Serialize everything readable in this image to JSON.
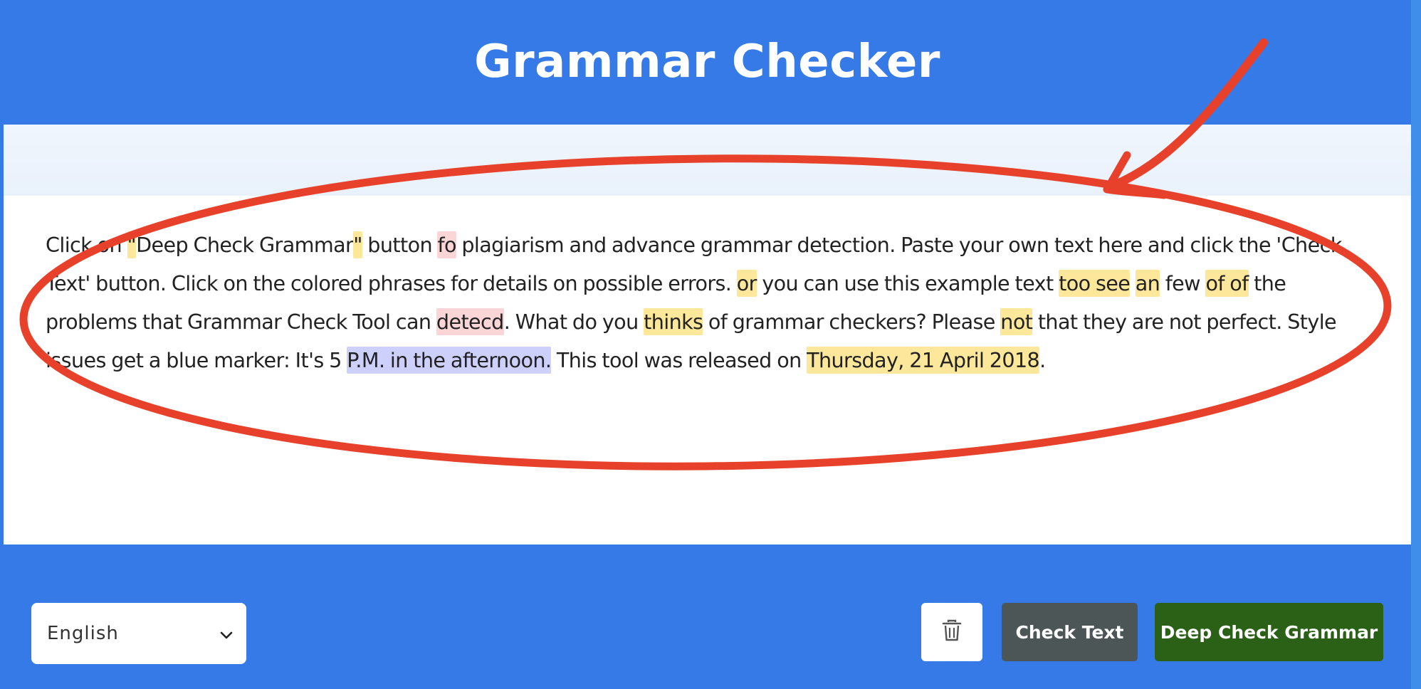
{
  "app": {
    "title": "Grammar Checker"
  },
  "editor": {
    "segments": [
      {
        "text": "Click on ",
        "mark": ""
      },
      {
        "text": "\"",
        "mark": "yellow"
      },
      {
        "text": "Deep Check Grammar",
        "mark": ""
      },
      {
        "text": "\"",
        "mark": "yellow"
      },
      {
        "text": " button ",
        "mark": ""
      },
      {
        "text": "fo",
        "mark": "red"
      },
      {
        "text": " plagiarism and advance grammar detection. Paste your own text here and click the 'Check Text' button. Click on the colored phrases for details on possible errors. ",
        "mark": ""
      },
      {
        "text": "or",
        "mark": "yellow"
      },
      {
        "text": " you can use this example text ",
        "mark": ""
      },
      {
        "text": "too see",
        "mark": "yellow"
      },
      {
        "text": " ",
        "mark": ""
      },
      {
        "text": "an",
        "mark": "yellow"
      },
      {
        "text": " few ",
        "mark": ""
      },
      {
        "text": "of of",
        "mark": "yellow"
      },
      {
        "text": " the problems that Grammar Check Tool can ",
        "mark": ""
      },
      {
        "text": "detecd",
        "mark": "red"
      },
      {
        "text": ". What do you ",
        "mark": ""
      },
      {
        "text": "thinks",
        "mark": "yellow"
      },
      {
        "text": " of grammar checkers? Please ",
        "mark": ""
      },
      {
        "text": "not",
        "mark": "yellow"
      },
      {
        "text": " that they are not perfect. Style issues get a blue marker: It's 5 ",
        "mark": ""
      },
      {
        "text": "P.M. in the afternoon.",
        "mark": "blue"
      },
      {
        "text": " This tool was released on ",
        "mark": ""
      },
      {
        "text": "Thursday, 21 April 2018",
        "mark": "yellow"
      },
      {
        "text": ".",
        "mark": ""
      }
    ]
  },
  "footer": {
    "language": {
      "selected": "English",
      "icon": "chevron-down-icon"
    },
    "clear": {
      "icon": "trash-icon"
    },
    "check_label": "Check Text",
    "deep_check_label": "Deep Check Grammar"
  },
  "colors": {
    "brand_blue": "#357ae6",
    "highlight_yellow": "#fde79a",
    "highlight_red": "#fcd6d6",
    "highlight_blue": "#cdd0fb",
    "check_button": "#4c5657",
    "deep_check_button": "#2a6116",
    "annotation_red": "#e8412b"
  }
}
